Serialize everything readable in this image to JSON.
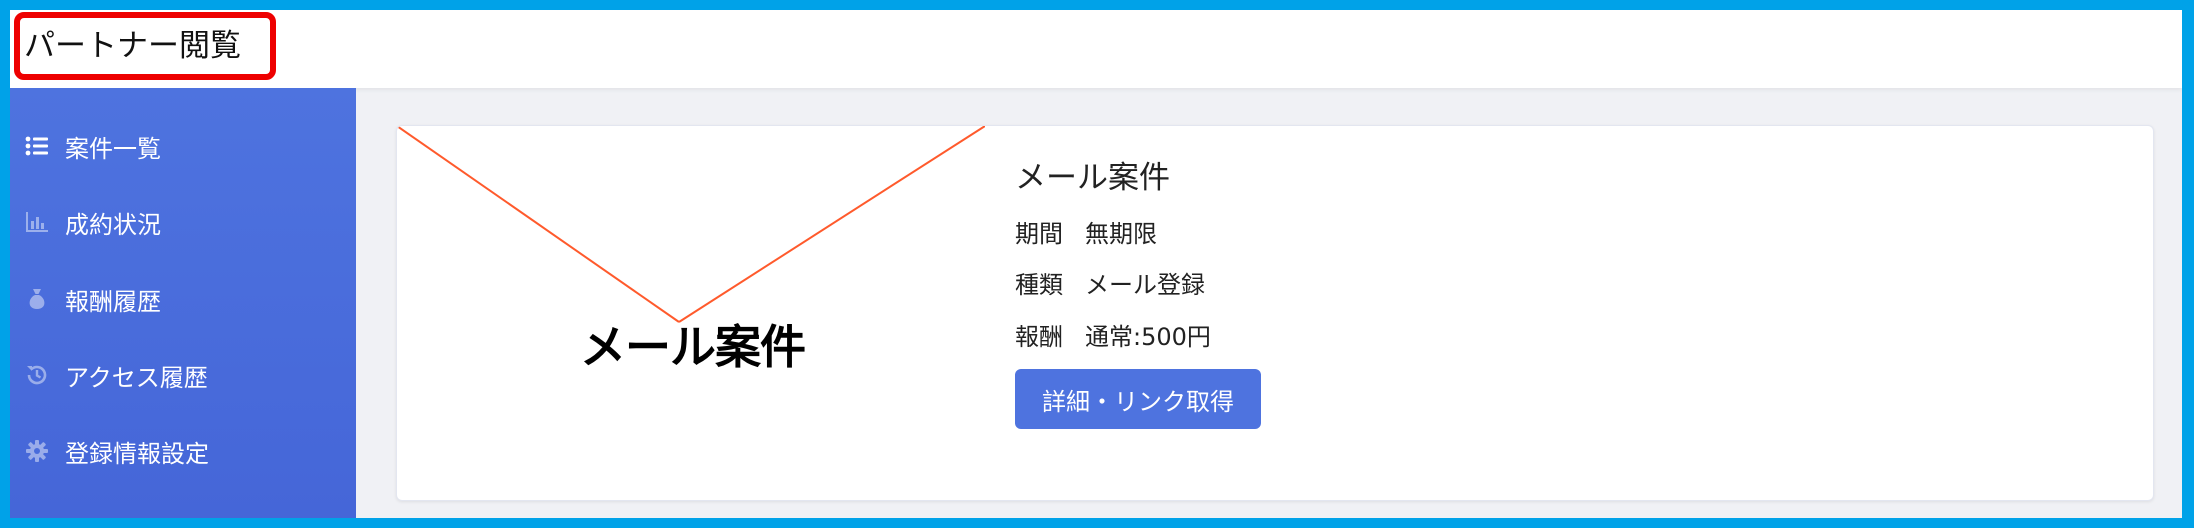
{
  "header": {
    "title": "パートナー閲覧"
  },
  "sidebar": {
    "items": [
      {
        "label": "案件一覧",
        "icon": "list-icon",
        "active": true
      },
      {
        "label": "成約状況",
        "icon": "bar-chart-icon",
        "active": false
      },
      {
        "label": "報酬履歴",
        "icon": "money-bag-icon",
        "active": false
      },
      {
        "label": "アクセス履歴",
        "icon": "history-icon",
        "active": false
      },
      {
        "label": "登録情報設定",
        "icon": "gear-icon",
        "active": false
      }
    ]
  },
  "card": {
    "thumbnail_text": "メール案件",
    "title": "メール案件",
    "rows": [
      {
        "key": "期間",
        "value": "無期限"
      },
      {
        "key": "種類",
        "value": "メール登録"
      },
      {
        "key": "報酬",
        "value": "通常:500円"
      }
    ],
    "button_label": "詳細・リンク取得"
  },
  "colors": {
    "sidebar": "#4e73df",
    "button": "#4e73df",
    "highlight_border": "#ee0000",
    "page_border": "#00a2e8",
    "thumbnail_lines": "#ff5a2c"
  }
}
